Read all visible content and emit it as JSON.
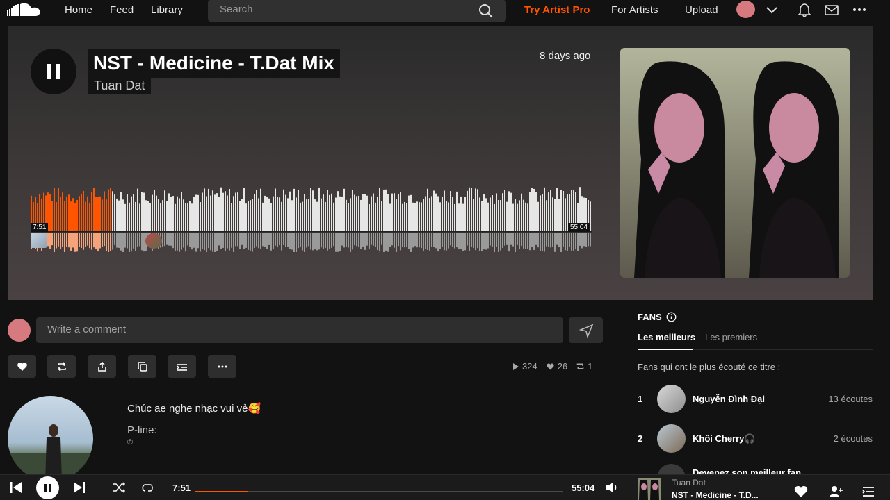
{
  "nav": {
    "home": "Home",
    "feed": "Feed",
    "library": "Library",
    "search_placeholder": "Search",
    "try_pro": "Try Artist Pro",
    "for_artists": "For Artists",
    "upload": "Upload",
    "icons": [
      "soundcloud-logo",
      "search-icon",
      "chevron-down-icon",
      "bell-icon",
      "mail-icon",
      "more-icon"
    ]
  },
  "track": {
    "title": "NST - Medicine - T.Dat Mix",
    "artist": "Tuan Dat",
    "posted": "8 days ago",
    "current_time": "7:51",
    "duration": "55:04",
    "progress_fraction": 0.1426,
    "accent": "#ff5500"
  },
  "comment": {
    "placeholder": "Write a comment"
  },
  "stats": {
    "plays": "324",
    "likes": "26",
    "reposts": "1"
  },
  "description": {
    "text": "Chúc ae nghe nhạc vui vẻ🥰",
    "pline_label": "P-line:",
    "pline_mark": "℗"
  },
  "fans": {
    "heading": "FANS",
    "tab_best": "Les meilleurs",
    "tab_first": "Les premiers",
    "subtitle": "Fans qui ont le plus écouté ce titre :",
    "list": [
      {
        "rank": "1",
        "name": "Nguyễn Đình Đại",
        "plays": "13 écoutes"
      },
      {
        "rank": "2",
        "name": "Khôi Cherry🎧",
        "plays": "2 écoutes"
      },
      {
        "rank": "",
        "name": "Devenez son meilleur fan",
        "plays": ""
      }
    ]
  },
  "player": {
    "current": "7:51",
    "duration": "55:04",
    "artist": "Tuan Dat",
    "title": "NST - Medicine - T.D..."
  }
}
